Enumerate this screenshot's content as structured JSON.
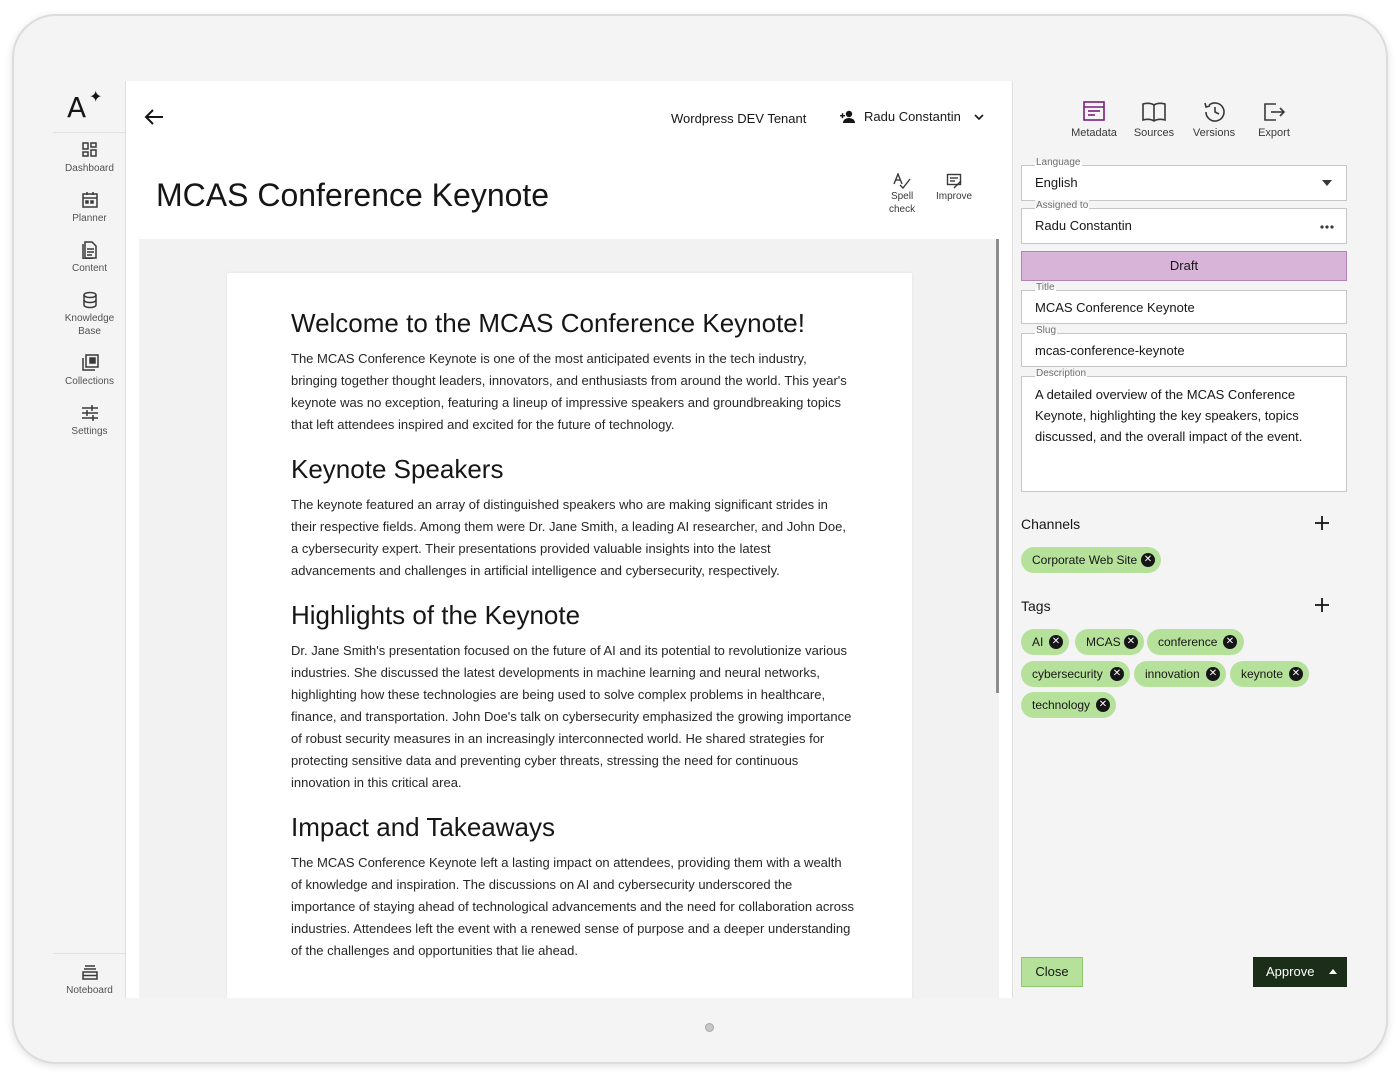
{
  "brand": {
    "logo_letter": "A",
    "logo_star": "✦"
  },
  "nav": {
    "items": [
      {
        "label": "Dashboard",
        "icon": "dashboard-icon"
      },
      {
        "label": "Planner",
        "icon": "calendar-icon"
      },
      {
        "label": "Content",
        "icon": "document-icon"
      },
      {
        "label": "Knowledge",
        "label2": "Base",
        "icon": "database-icon"
      },
      {
        "label": "Collections",
        "icon": "collections-icon"
      },
      {
        "label": "Settings",
        "icon": "sliders-icon"
      }
    ],
    "bottom": {
      "label": "Noteboard",
      "icon": "noteboard-icon"
    }
  },
  "header": {
    "tenant": "Wordpress DEV Tenant",
    "user": "Radu Constantin"
  },
  "page": {
    "title": "MCAS Conference Keynote",
    "tools": {
      "spell_check_1": "Spell",
      "spell_check_2": "check",
      "improve": "Improve"
    }
  },
  "document": {
    "sections": [
      {
        "heading": "Welcome to the MCAS Conference Keynote!",
        "body": "The MCAS Conference Keynote is one of the most anticipated events in the tech industry, bringing together thought leaders, innovators, and enthusiasts from around the world. This year's keynote was no exception, featuring a lineup of impressive speakers and groundbreaking topics that left attendees inspired and excited for the future of technology."
      },
      {
        "heading": "Keynote Speakers",
        "body": "The keynote featured an array of distinguished speakers who are making significant strides in their respective fields. Among them were Dr. Jane Smith, a leading AI researcher, and John Doe, a cybersecurity expert. Their presentations provided valuable insights into the latest advancements and challenges in artificial intelligence and cybersecurity, respectively."
      },
      {
        "heading": "Highlights of the Keynote",
        "body": "Dr. Jane Smith's presentation focused on the future of AI and its potential to revolutionize various industries. She discussed the latest developments in machine learning and neural networks, highlighting how these technologies are being used to solve complex problems in healthcare, finance, and transportation. John Doe's talk on cybersecurity emphasized the growing importance of robust security measures in an increasingly interconnected world. He shared strategies for protecting sensitive data and preventing cyber threats, stressing the need for continuous innovation in this critical area."
      },
      {
        "heading": "Impact and Takeaways",
        "body": "The MCAS Conference Keynote left a lasting impact on attendees, providing them with a wealth of knowledge and inspiration. The discussions on AI and cybersecurity underscored the importance of staying ahead of technological advancements and the need for collaboration across industries. Attendees left the event with a renewed sense of purpose and a deeper understanding of the challenges and opportunities that lie ahead."
      }
    ]
  },
  "panel": {
    "tabs": [
      {
        "label": "Metadata",
        "icon": "metadata-icon",
        "active": true
      },
      {
        "label": "Sources",
        "icon": "book-icon"
      },
      {
        "label": "Versions",
        "icon": "history-icon"
      },
      {
        "label": "Export",
        "icon": "export-icon"
      }
    ],
    "language": {
      "label": "Language",
      "value": "English"
    },
    "assigned": {
      "label": "Assigned to",
      "value": "Radu Constantin"
    },
    "status": "Draft",
    "title_field": {
      "label": "Title",
      "value": "MCAS Conference Keynote"
    },
    "slug": {
      "label": "Slug",
      "value": "mcas-conference-keynote"
    },
    "description": {
      "label": "Description",
      "value": "A detailed overview of the MCAS Conference Keynote, highlighting the key speakers, topics discussed, and the overall impact of the event."
    },
    "channels": {
      "title": "Channels",
      "items": [
        "Corporate Web Site"
      ]
    },
    "tags": {
      "title": "Tags",
      "items": [
        "AI",
        "MCAS",
        "conference",
        "cybersecurity",
        "innovation",
        "keynote",
        "technology"
      ]
    },
    "close_label": "Close",
    "approve_label": "Approve",
    "colors": {
      "accent_purple": "#d8b4d9",
      "chip_green": "#b6e19b",
      "approve_dark": "#1b2f18",
      "active_tab": "#7a1f7a"
    }
  }
}
